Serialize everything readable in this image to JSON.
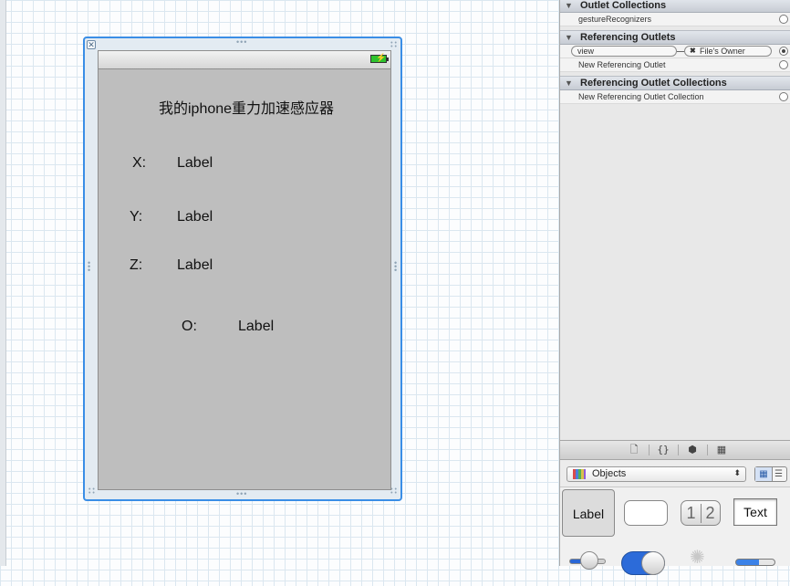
{
  "canvas": {
    "close_glyph": "✕",
    "title_label": "我的iphone重力加速感应器",
    "x_caption": "X:",
    "x_value": "Label",
    "y_caption": "Y:",
    "y_value": "Label",
    "z_caption": "Z:",
    "z_value": "Label",
    "o_caption": "O:",
    "o_value": "Label"
  },
  "inspector": {
    "outlet_collections": {
      "title": "Outlet Collections",
      "items": [
        "gestureRecognizers"
      ]
    },
    "referencing_outlets": {
      "title": "Referencing Outlets",
      "connection": {
        "outlet": "view",
        "target": "File's Owner"
      },
      "new_label": "New Referencing Outlet"
    },
    "referencing_outlet_collections": {
      "title": "Referencing Outlet Collections",
      "new_label": "New Referencing Outlet Collection"
    }
  },
  "library": {
    "tabs": [
      "file-template-icon",
      "code-snippet-icon",
      "object-cube-icon",
      "media-icon"
    ],
    "selector_label": "Objects",
    "tiles": {
      "label_tile": "Label",
      "segmented_1": "1",
      "segmented_2": "2",
      "textfield_tile": "Text"
    }
  },
  "colors": {
    "selection_border": "#3a8ee6",
    "view_background": "#bebebe",
    "switch_on": "#2c6bd9"
  }
}
